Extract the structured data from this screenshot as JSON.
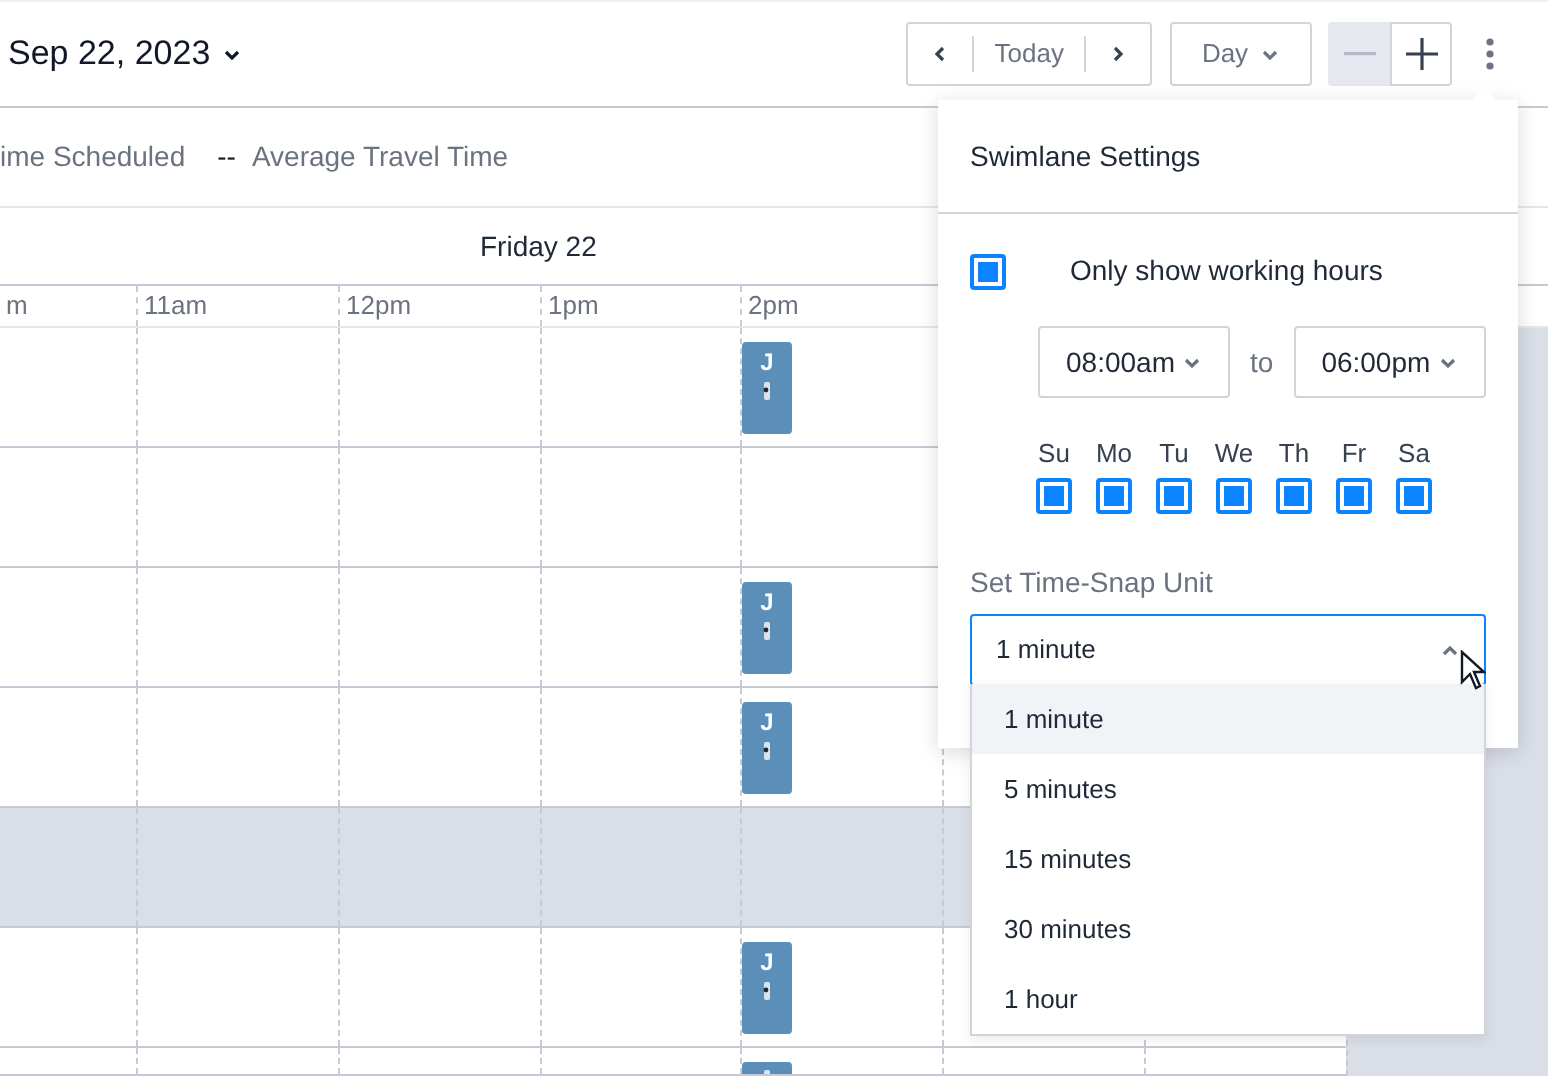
{
  "header": {
    "date": "Sep 22, 2023",
    "today": "Today",
    "view": "Day",
    "zoom_out_disabled": true
  },
  "stats": [
    {
      "label": "ime Scheduled"
    },
    {
      "value": "--",
      "label": "Average Travel Time"
    }
  ],
  "day_title": "Friday 22",
  "hours": [
    "m",
    "11am",
    "12pm",
    "1pm",
    "2pm"
  ],
  "rows": [
    {
      "shaded": false,
      "events": [
        {
          "kind": "visit",
          "label": "J"
        }
      ]
    },
    {
      "shaded": false,
      "events": []
    },
    {
      "shaded": false,
      "events": [
        {
          "kind": "visit",
          "label": "J"
        }
      ]
    },
    {
      "shaded": false,
      "events": [
        {
          "kind": "visit",
          "label": "J"
        }
      ]
    },
    {
      "shaded": true,
      "events": []
    },
    {
      "shaded": false,
      "events": [
        {
          "kind": "visit",
          "label": "J"
        }
      ]
    },
    {
      "shaded": false,
      "events": [
        {
          "kind": "visit"
        }
      ]
    }
  ],
  "settings": {
    "title": "Swimlane Settings",
    "working_hours": {
      "label": "Only show working hours",
      "checked": true,
      "from": "08:00am",
      "to_label": "to",
      "to": "06:00pm"
    },
    "days": [
      {
        "label": "Su",
        "checked": true
      },
      {
        "label": "Mo",
        "checked": true
      },
      {
        "label": "Tu",
        "checked": true
      },
      {
        "label": "We",
        "checked": true
      },
      {
        "label": "Th",
        "checked": true
      },
      {
        "label": "Fr",
        "checked": true
      },
      {
        "label": "Sa",
        "checked": true
      }
    ],
    "snap_label": "Set Time-Snap Unit",
    "snap_value": "1 minute",
    "snap_options": [
      {
        "label": "1 minute",
        "selected": true
      },
      {
        "label": "5 minutes",
        "selected": false
      },
      {
        "label": "15 minutes",
        "selected": false
      },
      {
        "label": "30 minutes",
        "selected": false
      },
      {
        "label": "1 hour",
        "selected": false
      }
    ]
  }
}
